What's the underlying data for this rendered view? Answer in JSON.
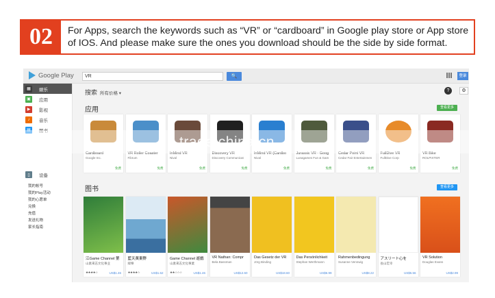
{
  "banner": {
    "step": "02",
    "text": "For Apps, search the keywords such as “VR” or “cardboard” in Google play store or App store of IOS. And please make sure the ones you download should be the side by side format."
  },
  "topbar": {
    "logo": "Google Play",
    "search_value": "VR",
    "search_button": "🔍",
    "signin_label": "登录"
  },
  "nav": {
    "items": [
      {
        "label": "娱乐",
        "icon": "apps-icon"
      },
      {
        "label": "应用",
        "icon": "android-icon"
      },
      {
        "label": "影视",
        "icon": "movie-icon"
      },
      {
        "label": "音乐",
        "icon": "headphones-icon"
      },
      {
        "label": "图书",
        "icon": "book-icon"
      }
    ],
    "devices": "设备",
    "links": [
      "我的帐号",
      "我的Play活动",
      "我的心愿单",
      "兑换",
      "充值",
      "发送礼物",
      "家长指南"
    ]
  },
  "main": {
    "breadcrumb": "搜索",
    "filter": "所有价格 ▾",
    "apps_section": "应用",
    "apps_more": "查看更多",
    "books_section": "图书",
    "books_more": "查看更多"
  },
  "apps": [
    {
      "title": "Cardboard",
      "dev": "Google Inc.",
      "price": "免费",
      "color": "#c98a3a"
    },
    {
      "title": "VR Roller Coaster",
      "dev": "Fibrum",
      "price": "免费",
      "color": "#4b8fc9"
    },
    {
      "title": "InMind VR",
      "dev": "Nival",
      "price": "免费",
      "color": "#6a4a3a"
    },
    {
      "title": "Discovery VR",
      "dev": "Discovery Communicat",
      "price": "免费",
      "color": "#1f1f1f"
    },
    {
      "title": "InMind VR (Cardbo",
      "dev": "Nival",
      "price": "免费",
      "color": "#2a7fd0"
    },
    {
      "title": "Jurassic VR - Goog",
      "dev": "Lunagames Fun & Gam",
      "price": "免费",
      "color": "#4f5a3c"
    },
    {
      "title": "Cedar Point VR",
      "dev": "Cedar Fair Entertainmen",
      "price": "免费",
      "color": "#3a4f8a"
    },
    {
      "title": "FullDive VR",
      "dev": "FullDive Corp",
      "price": "免费",
      "color": "#e78b2a"
    },
    {
      "title": "VR Bike",
      "dev": "ROLPIXTER",
      "price": "免费",
      "color": "#8a2a22"
    }
  ],
  "books": [
    {
      "title": "江Game Channel 第",
      "author": "山素来志文化事业",
      "price": "US$1.46",
      "color": "#2f7d3a"
    },
    {
      "title": "藍天黃東野",
      "author": "緯樂",
      "price": "US$1.62",
      "color": "#6fa8d0"
    },
    {
      "title": "Game Channel 遊戲",
      "author": "山素来志文化事業",
      "price": "US$1.46",
      "color": "#c9572a"
    },
    {
      "title": "VR Nathan: Compr",
      "author": "Bela Bassman",
      "price": "US$12.60",
      "color": "#6b6b6b"
    },
    {
      "title": "Das Gesetz der VR",
      "author": "Jörg Binding",
      "price": "US$18.60",
      "color": "#f0c020"
    },
    {
      "title": "Das Persönlichkeit",
      "author": "Stephan Werthmann",
      "price": "US$6.99",
      "color": "#f2c61f"
    },
    {
      "title": "Rahmenbedingung",
      "author": "Susanne Vennwig",
      "price": "US$8.22",
      "color": "#f4e9b0"
    },
    {
      "title": "アスリート心を",
      "author": "長山宏幸",
      "price": "US$5.56",
      "color": "#ffffff"
    },
    {
      "title": "VR Solution",
      "author": "Douglas Evans",
      "price": "US$2.99",
      "color": "#f07020"
    }
  ],
  "watermark": "trade.china.cn"
}
